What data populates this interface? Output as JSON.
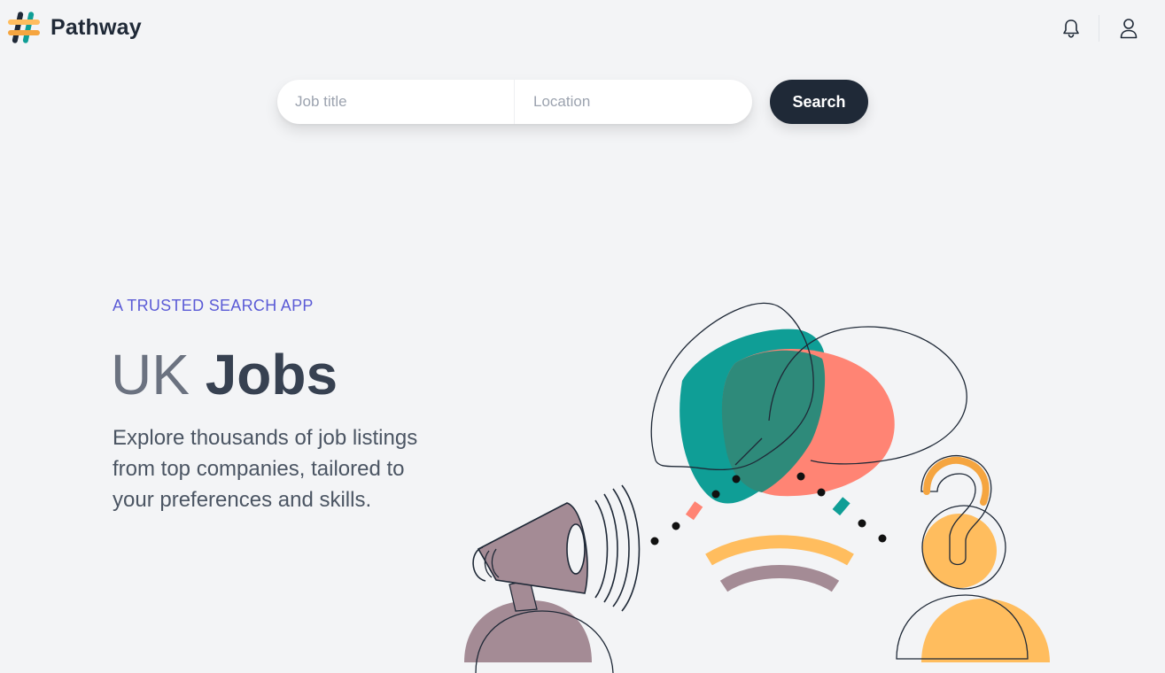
{
  "header": {
    "brand": "Pathway",
    "logo_icon": "hashtag-logo-icon",
    "notification_icon": "bell-icon",
    "account_icon": "user-icon"
  },
  "search": {
    "job_title_placeholder": "Job title",
    "location_placeholder": "Location",
    "button_label": "Search"
  },
  "hero": {
    "tagline": "A TRUSTED SEARCH APP",
    "title_light": "UK",
    "title_bold": "Jobs",
    "description": "Explore thousands of job listings from top companies, tailored to your preferences and skills."
  },
  "colors": {
    "background": "#f3f4f6",
    "primary_dark": "#1f2937",
    "accent_indigo": "#5b5bd6",
    "teal": "#0f9e96",
    "coral": "#ff8474",
    "yellow": "#ffbd5e",
    "mauve": "#a48b95"
  }
}
